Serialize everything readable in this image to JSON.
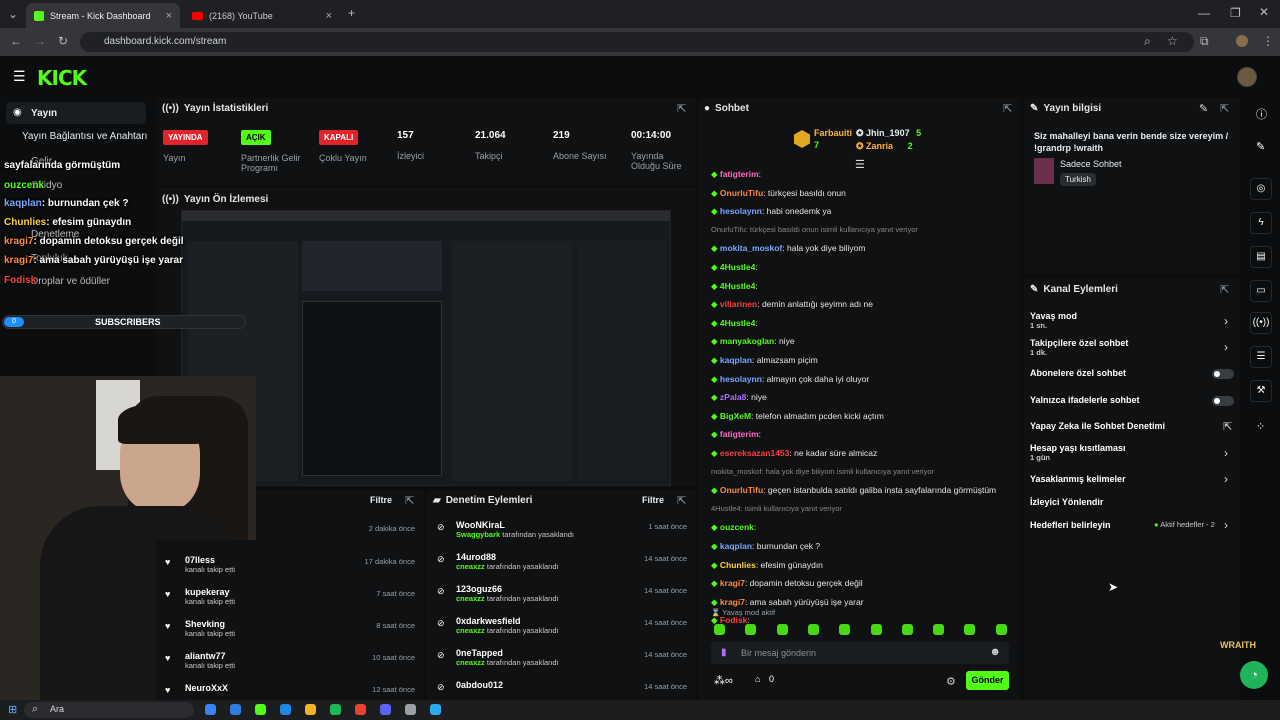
{
  "browser": {
    "tabs": [
      "Stream - Kick Dashboard",
      "(2168) YouTube"
    ],
    "url": "dashboard.kick.com/stream"
  },
  "sidebar": {
    "items": [
      "Yayın",
      "Yayın Bağlantısı ve Anahtarı",
      "Gelir",
      "Stüdyo",
      "Denetleme",
      "Topluluk",
      "Droplar ve ödüller"
    ]
  },
  "overlay": {
    "lines": [
      {
        "user": "",
        "text": "sayfalarında görmüştüm"
      },
      {
        "user": "ouzcenk",
        "text": ""
      },
      {
        "user": "kaqplan",
        "text": ": burnundan çek ?"
      },
      {
        "user": "Chunlies",
        "text": ": efesim günaydın"
      },
      {
        "user": "kragi7",
        "text": ": dopamin detoksu gerçek değil"
      },
      {
        "user": "kragi7",
        "text": ": ama sabah yürüyüşü işe yarar"
      },
      {
        "user": "Fodisk",
        "text": ""
      }
    ],
    "subscribers_label": "SUBSCRIBERS",
    "subscribers_count": "0"
  },
  "stats": {
    "title": "Yayın İstatistikleri",
    "items": [
      {
        "value": "YAYINDA",
        "label": "Yayın",
        "color": "#e0242a"
      },
      {
        "value": "AÇIK",
        "label": "Partnerlik Gelir Programı",
        "color": "#53fc18"
      },
      {
        "value": "KAPALI",
        "label": "Çoklu Yayın",
        "color": "#e0242a"
      },
      {
        "value": "157",
        "label": "İzleyici"
      },
      {
        "value": "21.064",
        "label": "Takipçi"
      },
      {
        "value": "219",
        "label": "Abone Sayısı"
      },
      {
        "value": "00:14:00",
        "label": "Yayında Olduğu Süre"
      }
    ]
  },
  "preview": {
    "title": "Yayın Ön İzlemesi"
  },
  "activity": {
    "filter": "Filtre",
    "items": [
      {
        "name": "",
        "sub": "",
        "time": "2 dakika önce"
      },
      {
        "name": "07lless",
        "sub": "kanalı takip etti",
        "time": "17 dakika önce"
      },
      {
        "name": "kupekeray",
        "sub": "kanalı takip etti",
        "time": "7 saat önce"
      },
      {
        "name": "Shevking",
        "sub": "kanalı takip etti",
        "time": "8 saat önce"
      },
      {
        "name": "aliantw77",
        "sub": "kanalı takip etti",
        "time": "10 saat önce"
      },
      {
        "name": "NeuroXxX",
        "sub": "",
        "time": "12 saat önce"
      }
    ]
  },
  "mod": {
    "title": "Denetim Eylemleri",
    "filter": "Filtre",
    "items": [
      {
        "name": "WooNKiraL",
        "by": "Swaggybark",
        "sub": "tarafından yasaklandı",
        "time": "1 saat önce"
      },
      {
        "name": "14urod88",
        "by": "cneaxzz",
        "sub": "tarafından yasaklandı",
        "time": "14 saat önce"
      },
      {
        "name": "123oguz66",
        "by": "cneaxzz",
        "sub": "tarafından yasaklandı",
        "time": "14 saat önce"
      },
      {
        "name": "0xdarkwesfield",
        "by": "cneaxzz",
        "sub": "tarafından yasaklandı",
        "time": "14 saat önce"
      },
      {
        "name": "0neTapped",
        "by": "cneaxzz",
        "sub": "tarafından yasaklandı",
        "time": "14 saat önce"
      },
      {
        "name": "0abdou012",
        "by": "",
        "sub": "",
        "time": "14 saat önce"
      }
    ]
  },
  "chat": {
    "title": "Sohbet",
    "top": [
      {
        "name": "Farbauiti",
        "count": "7"
      },
      {
        "name": "Jhin_1907",
        "count": "5"
      },
      {
        "name": "Zanria",
        "count": "2"
      }
    ],
    "messages": [
      {
        "user": "fatigterim",
        "text": ":",
        "color": "#ff69c4"
      },
      {
        "user": "OnurluTifu",
        "text": ": türkçesi basıldı onun",
        "color": "#ff8a3d"
      },
      {
        "user": "hesolaynn",
        "text": ": habi onedemk ya",
        "color": "#7aa7ff"
      },
      {
        "user": "",
        "text": "OnurluTifu: türkçesi basıldı onun isimli kullanıcıya yanıt veriyor",
        "color": "#888"
      },
      {
        "user": "mokita_moskof",
        "text": ": hala yok diye biliyom",
        "color": "#7aa7ff"
      },
      {
        "user": "4Hustle4",
        "text": ":",
        "color": "#53fc18"
      },
      {
        "user": "4Hustle4",
        "text": ":",
        "color": "#53fc18"
      },
      {
        "user": "viliarinen",
        "text": ": demin anlattığı şeyimn adı ne",
        "color": "#ff3d3d"
      },
      {
        "user": "4Hustle4",
        "text": ":",
        "color": "#53fc18"
      },
      {
        "user": "manyakoglan",
        "text": ": niye",
        "color": "#53fc18"
      },
      {
        "user": "kaqplan",
        "text": ": almazsam piçim",
        "color": "#7aa7ff"
      },
      {
        "user": "hesolaynn",
        "text": ": almayın çok daha iyi oluyor",
        "color": "#7aa7ff"
      },
      {
        "user": "zPala8",
        "text": ": niye",
        "color": "#b06bff"
      },
      {
        "user": "BigXeM",
        "text": ": telefon almadım pcden kicki açtım",
        "color": "#53fc18"
      },
      {
        "user": "fatigterim",
        "text": ":",
        "color": "#ff69c4"
      },
      {
        "user": "esereksazan1453",
        "text": ": ne kadar süre almicaz",
        "color": "#ff3d3d"
      },
      {
        "user": "",
        "text": "mokita_moskof: hala yok diye biliyom isimli kullanıcıya yanıt veriyor",
        "color": "#888"
      },
      {
        "user": "OnurluTifu",
        "text": ": geçen istanbulda satıldı galiba insta sayfalarında görmüştüm",
        "color": "#ff8a3d"
      },
      {
        "user": "",
        "text": "4Hustle4: isimli kullanıcıya yanıt veriyor",
        "color": "#888"
      },
      {
        "user": "ouzcenk",
        "text": ":",
        "color": "#53fc18"
      },
      {
        "user": "kaqplan",
        "text": ": burnundan çek ?",
        "color": "#7aa7ff"
      },
      {
        "user": "Chunlies",
        "text": ": efesim günaydın",
        "color": "#ffd23d"
      },
      {
        "user": "kragi7",
        "text": ": dopamin detoksu gerçek değil",
        "color": "#ff8a3d"
      },
      {
        "user": "kragi7",
        "text": ": ama sabah yürüyüşü işe yarar",
        "color": "#ff8a3d"
      },
      {
        "user": "Fodisk",
        "text": ":",
        "color": "#ff3d3d"
      }
    ],
    "slow_mode": "Yavaş mod aktif",
    "placeholder": "Bir mesaj gönderin",
    "send": "Gönder",
    "points": "0"
  },
  "info": {
    "title": "Yayın bilgisi",
    "stream_title": "Siz mahalleyi bana verin bende size vereyim / !grandrp !wraith",
    "category": "Sadece Sohbet",
    "tag": "Turkish"
  },
  "actions": {
    "title": "Kanal Eylemleri",
    "items": [
      {
        "label": "Yavaş mod",
        "sub": "1 sn."
      },
      {
        "label": "Takipçilere özel sohbet",
        "sub": "1 dk."
      },
      {
        "label": "Abonelere özel sohbet",
        "sub": ""
      },
      {
        "label": "Yalnızca ifadelerle sohbet",
        "sub": ""
      },
      {
        "label": "Yapay Zeka ile Sohbet Denetimi",
        "sub": ""
      },
      {
        "label": "Hesap yaşı kısıtlaması",
        "sub": "1 gün"
      },
      {
        "label": "Yasaklanmış kelimeler",
        "sub": ""
      },
      {
        "label": "İzleyici Yönlendir",
        "sub": ""
      },
      {
        "label": "Hedefleri belirleyin",
        "sub": ""
      }
    ],
    "goals_status": "Aktif hedefler - 2"
  },
  "taskbar": {
    "search": "Ara"
  },
  "watermark": "WRAITH"
}
